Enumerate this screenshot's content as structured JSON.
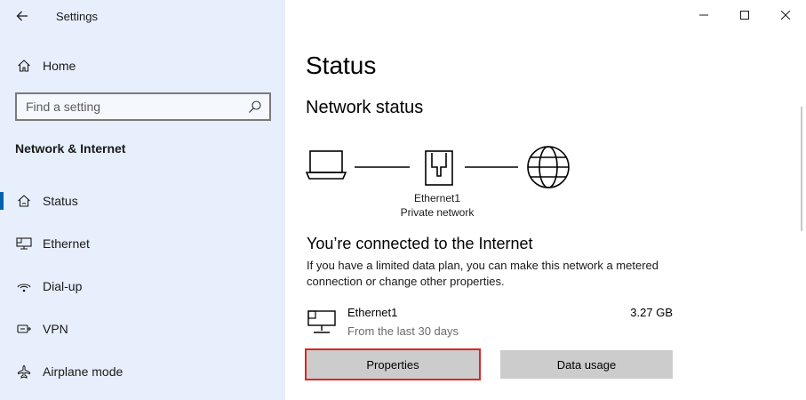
{
  "window": {
    "title": "Settings"
  },
  "sidebar": {
    "home_label": "Home",
    "search_placeholder": "Find a setting",
    "section_title": "Network & Internet",
    "items": [
      {
        "label": "Status",
        "icon": "home-network-icon",
        "active": true
      },
      {
        "label": "Ethernet",
        "icon": "ethernet-icon",
        "active": false
      },
      {
        "label": "Dial-up",
        "icon": "dial-up-icon",
        "active": false
      },
      {
        "label": "VPN",
        "icon": "vpn-icon",
        "active": false
      },
      {
        "label": "Airplane mode",
        "icon": "airplane-icon",
        "active": false
      }
    ]
  },
  "main": {
    "page_title": "Status",
    "network_status_heading": "Network status",
    "adapter_name": "Ethernet1",
    "adapter_network": "Private network",
    "connected_heading": "You’re connected to the Internet",
    "description": "If you have a limited data plan, you can make this network a metered connection or change other properties.",
    "connection": {
      "name": "Ethernet1",
      "period": "From the last 30 days",
      "usage": "3.27 GB"
    },
    "buttons": {
      "properties": "Properties",
      "data_usage": "Data usage"
    }
  },
  "colors": {
    "sidebar_bg": "#e6effb",
    "accent": "#0063b1",
    "button_bg": "#cccccc",
    "highlight": "#e02424"
  }
}
